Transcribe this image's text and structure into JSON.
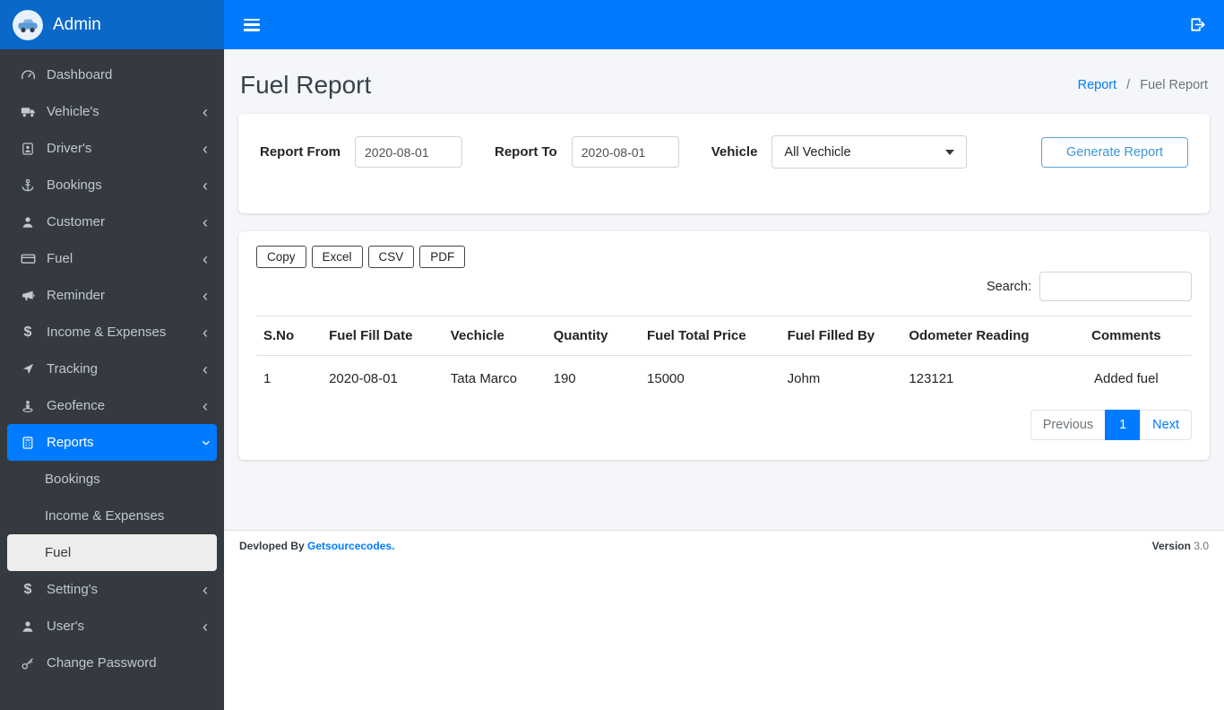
{
  "colors": {
    "accent": "#007bff",
    "brand_bg": "#0a68c9",
    "sidebar_bg": "#343a40",
    "content_bg": "#f4f6f9",
    "outline_button": "#3d96d2"
  },
  "topbar": {
    "brand": "Admin"
  },
  "sidebar": {
    "items": [
      {
        "label": "Dashboard",
        "icon": "tachometer-icon"
      },
      {
        "label": "Vehicle's",
        "icon": "truck-icon"
      },
      {
        "label": "Driver's",
        "icon": "id-badge-icon"
      },
      {
        "label": "Bookings",
        "icon": "anchor-icon"
      },
      {
        "label": "Customer",
        "icon": "user-icon"
      },
      {
        "label": "Fuel",
        "icon": "fuel-card-icon"
      },
      {
        "label": "Reminder",
        "icon": "bullhorn-icon"
      },
      {
        "label": "Income & Expenses",
        "icon": "dollar-icon"
      },
      {
        "label": "Tracking",
        "icon": "location-arrow-icon"
      },
      {
        "label": "Geofence",
        "icon": "street-view-icon"
      },
      {
        "label": "Reports",
        "icon": "calculator-icon"
      },
      {
        "label": "Setting's",
        "icon": "dollar-icon"
      },
      {
        "label": "User's",
        "icon": "user-icon"
      },
      {
        "label": "Change Password",
        "icon": "key-icon"
      }
    ],
    "reports_submenu": [
      {
        "label": "Bookings"
      },
      {
        "label": "Income & Expenses"
      },
      {
        "label": "Fuel"
      }
    ]
  },
  "page": {
    "title": "Fuel Report",
    "breadcrumb": {
      "link": "Report",
      "separator": "/",
      "current": "Fuel Report"
    }
  },
  "filters": {
    "report_from_label": "Report From",
    "report_from_value": "2020-08-01",
    "report_to_label": "Report To",
    "report_to_value": "2020-08-01",
    "vehicle_label": "Vehicle",
    "vehicle_value": "All Vechicle",
    "generate_button": "Generate Report"
  },
  "datatable": {
    "export_buttons": [
      "Copy",
      "Excel",
      "CSV",
      "PDF"
    ],
    "search_label": "Search:",
    "search_value": "",
    "headers": [
      "S.No",
      "Fuel Fill Date",
      "Vechicle",
      "Quantity",
      "Fuel Total Price",
      "Fuel Filled By",
      "Odometer Reading",
      "Comments"
    ],
    "rows": [
      [
        "1",
        "2020-08-01",
        "Tata Marco",
        "190",
        "15000",
        "Johm",
        "123121",
        "Added fuel"
      ]
    ],
    "pagination": {
      "previous": "Previous",
      "page": "1",
      "next": "Next"
    }
  },
  "footer": {
    "developed_by": "Devloped By",
    "brand_link": "Getsourcecodes.",
    "version_label": "Version",
    "version_value": "3.0"
  }
}
